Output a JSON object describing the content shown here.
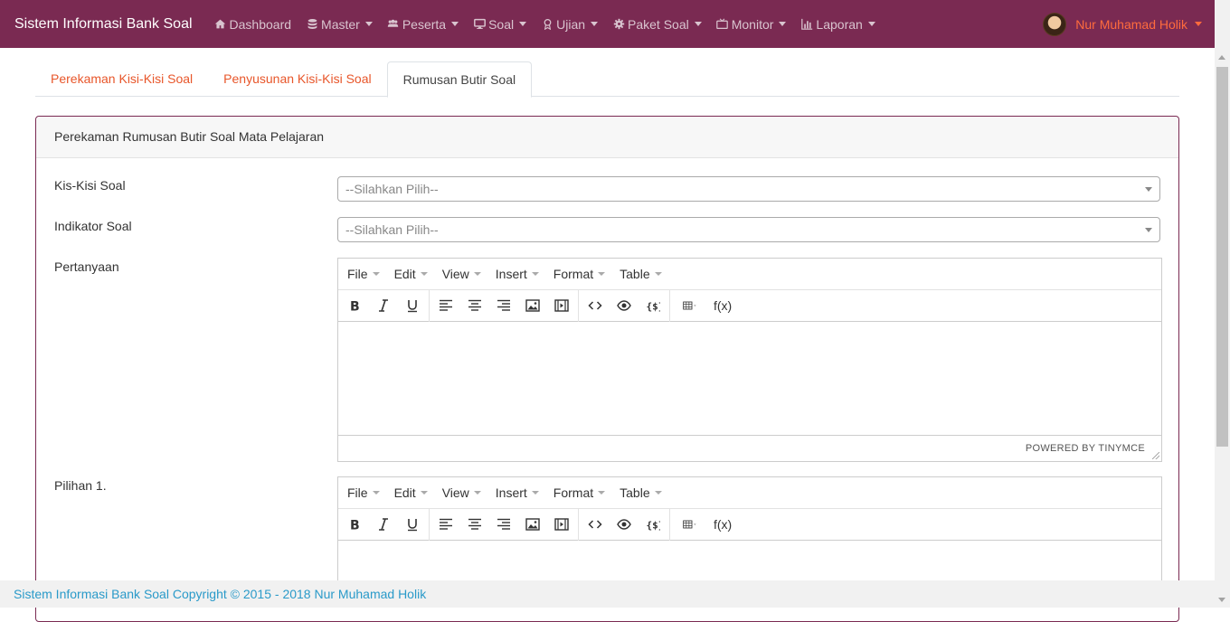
{
  "navbar": {
    "brand": "Sistem Informasi Bank Soal",
    "items": [
      {
        "label": "Dashboard",
        "icon": "home-icon",
        "dropdown": false
      },
      {
        "label": "Master",
        "icon": "database-icon",
        "dropdown": true
      },
      {
        "label": "Peserta",
        "icon": "users-icon",
        "dropdown": true
      },
      {
        "label": "Soal",
        "icon": "desktop-icon",
        "dropdown": true
      },
      {
        "label": "Ujian",
        "icon": "award-icon",
        "dropdown": true
      },
      {
        "label": "Paket Soal",
        "icon": "gear-icon",
        "dropdown": true
      },
      {
        "label": "Monitor",
        "icon": "tv-icon",
        "dropdown": true
      },
      {
        "label": "Laporan",
        "icon": "bar-chart-icon",
        "dropdown": true
      }
    ],
    "user": "Nur Muhamad Holik"
  },
  "tabs": [
    {
      "label": "Perekaman Kisi-Kisi Soal",
      "active": false
    },
    {
      "label": "Penyusunan Kisi-Kisi Soal",
      "active": false
    },
    {
      "label": "Rumusan Butir Soal",
      "active": true
    }
  ],
  "card": {
    "title": "Perekaman Rumusan Butir Soal Mata Pelajaran"
  },
  "form": {
    "kisi_label": "Kis-Kisi Soal",
    "kisi_placeholder": "--Silahkan Pilih--",
    "indikator_label": "Indikator Soal",
    "indikator_placeholder": "--Silahkan Pilih--",
    "pertanyaan_label": "Pertanyaan",
    "pilihan1_label": "Pilihan 1."
  },
  "editor": {
    "menus": [
      "File",
      "Edit",
      "View",
      "Insert",
      "Format",
      "Table"
    ],
    "fx_label": "f(x)",
    "powered_by": "POWERED BY TINYMCE"
  },
  "footer": {
    "text": "Sistem Informasi Bank Soal Copyright © 2015 - 2018 Nur Muhamad Holik"
  },
  "colors": {
    "navbar": "#7a2a52",
    "accent": "#e8562a",
    "footer_text": "#2a9ac9"
  }
}
